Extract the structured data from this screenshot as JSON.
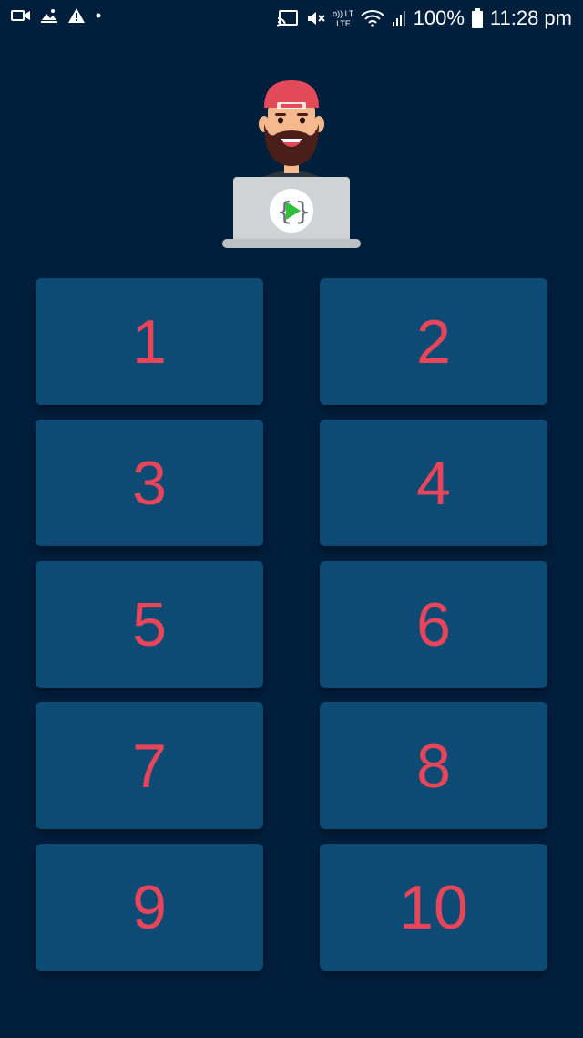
{
  "status_bar": {
    "left_icons": [
      "video-camera-icon",
      "photo-gallery-icon",
      "warning-icon",
      "dot-icon"
    ],
    "right_icons": [
      "cast-icon",
      "mute-icon",
      "volte-icon",
      "wifi-icon",
      "signal-icon",
      "battery-icon"
    ],
    "volte_label": "Vo)) LTE",
    "battery_percent": "100%",
    "time": "11:28 pm"
  },
  "hero": {
    "image": "developer-avatar-with-laptop-illustration",
    "laptop_logo": "{▶}",
    "colors": {
      "cap": "#e24a5a",
      "beard": "#4a1f1a",
      "laptop": "#cfd3d6",
      "play": "#2fbf3a"
    }
  },
  "tiles": [
    {
      "label": "1"
    },
    {
      "label": "2"
    },
    {
      "label": "3"
    },
    {
      "label": "4"
    },
    {
      "label": "5"
    },
    {
      "label": "6"
    },
    {
      "label": "7"
    },
    {
      "label": "8"
    },
    {
      "label": "9"
    },
    {
      "label": "10"
    }
  ],
  "colors": {
    "background": "#001f3d",
    "tile": "#0d4a74",
    "tile_text": "#e8455b"
  }
}
